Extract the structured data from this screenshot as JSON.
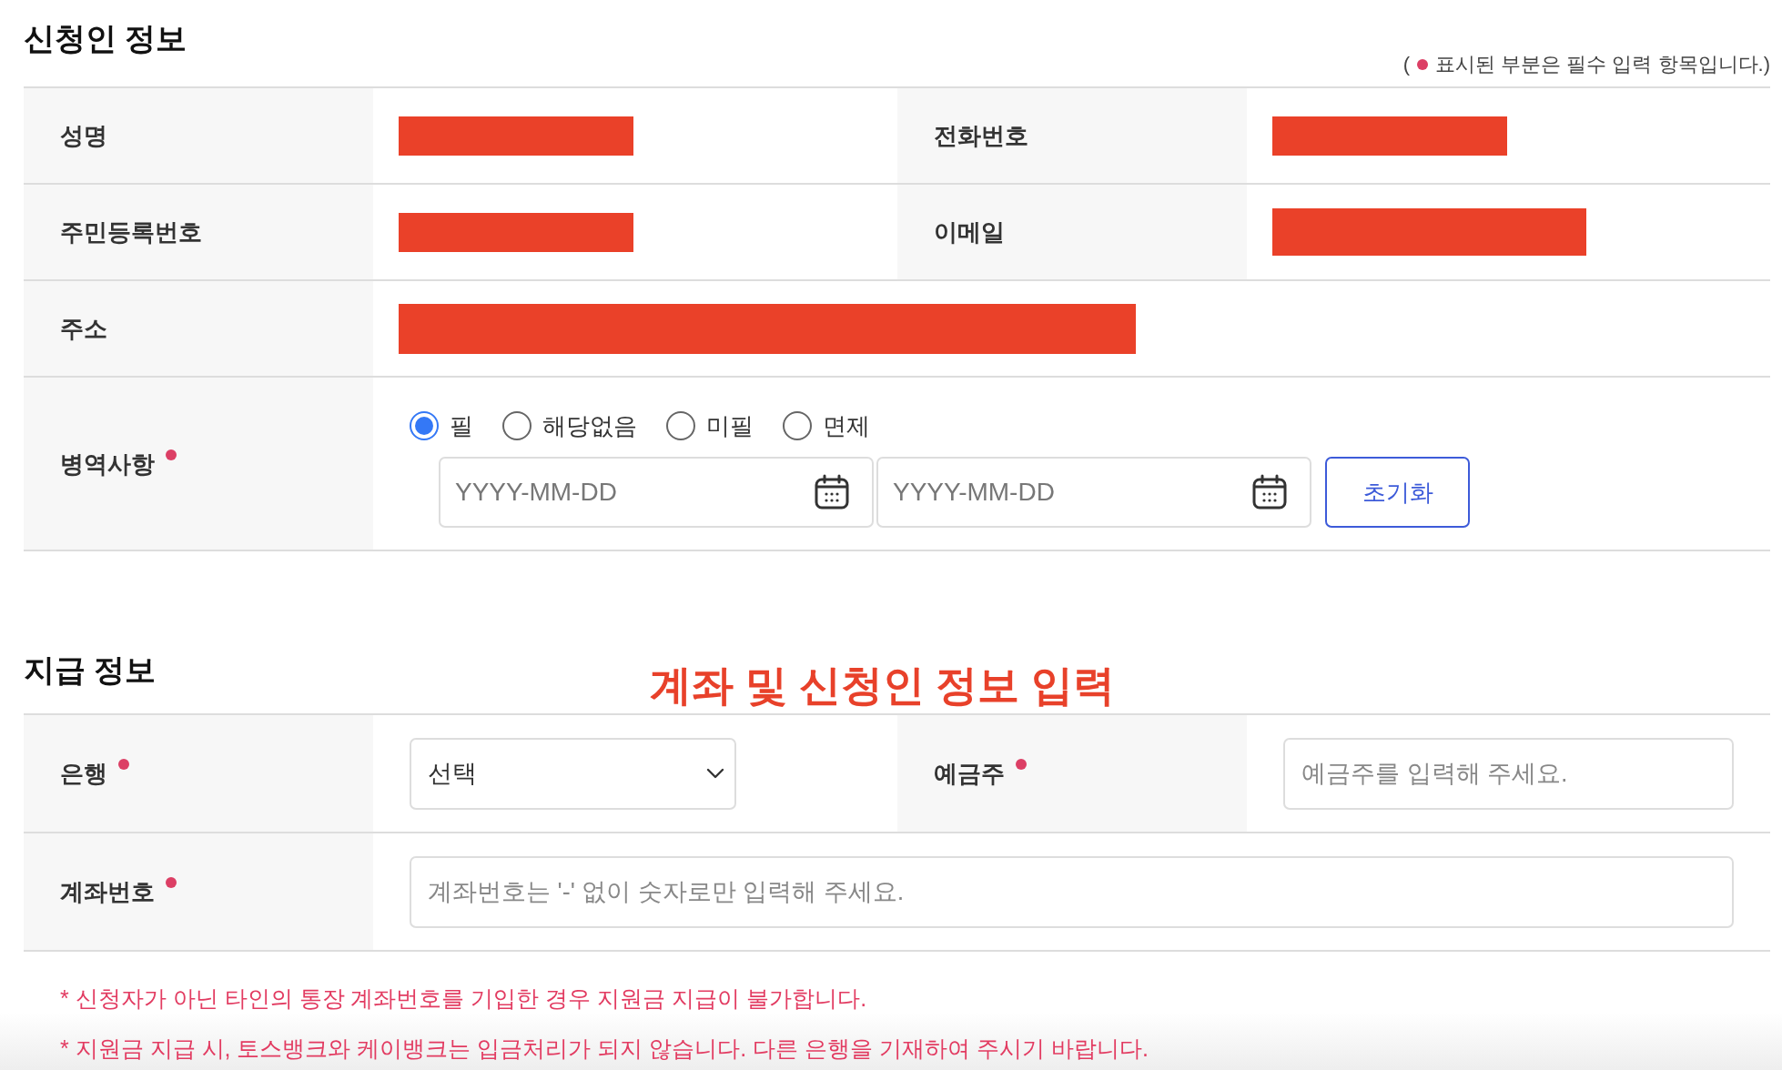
{
  "sections": [
    {
      "title": "신청인 정보",
      "note": {
        "open": "(",
        "text": "표시된 부분은 필수 입력 항목입니다.)"
      },
      "rows": [
        {
          "fields": [
            {
              "label": "성명",
              "required": false,
              "kind": "redacted"
            },
            {
              "label": "전화번호",
              "required": false,
              "kind": "redacted"
            }
          ]
        },
        {
          "fields": [
            {
              "label": "주민등록번호",
              "required": false,
              "kind": "redacted"
            },
            {
              "label": "이메일",
              "required": false,
              "kind": "redacted"
            }
          ]
        },
        {
          "fields": [
            {
              "label": "주소",
              "required": false,
              "kind": "redacted"
            }
          ]
        },
        {
          "fields": [
            {
              "label": "병역사항",
              "required": true,
              "kind": "military",
              "options": [
                {
                  "label": "필",
                  "selected": true
                },
                {
                  "label": "해당없음",
                  "selected": false
                },
                {
                  "label": "미필",
                  "selected": false
                },
                {
                  "label": "면제",
                  "selected": false
                }
              ],
              "date_fields": [
                {
                  "placeholder": "YYYY-MM-DD"
                },
                {
                  "placeholder": "YYYY-MM-DD"
                }
              ],
              "reset_button": "초기화"
            }
          ]
        }
      ]
    },
    {
      "title": "지급 정보",
      "annotation": "계좌 및 신청인 정보 입력",
      "rows": [
        {
          "fields": [
            {
              "label": "은행",
              "required": true,
              "kind": "select",
              "value": "선택"
            },
            {
              "label": "예금주",
              "required": true,
              "kind": "input",
              "placeholder": "예금주를 입력해 주세요."
            }
          ]
        },
        {
          "fields": [
            {
              "label": "계좌번호",
              "required": true,
              "kind": "input",
              "placeholder": "계좌번호는 '-' 없이 숫자로만 입력해 주세요."
            }
          ]
        }
      ]
    }
  ],
  "notices": [
    "* 신청자가 아닌 타인의 통장 계좌번호를 기입한 경우 지원금 지급이 불가합니다.",
    "* 지원금 지급 시, 토스뱅크와 케이뱅크는 입금처리가 되지 않습니다. 다른 은행을 기재하여 주시기 바랍니다."
  ]
}
